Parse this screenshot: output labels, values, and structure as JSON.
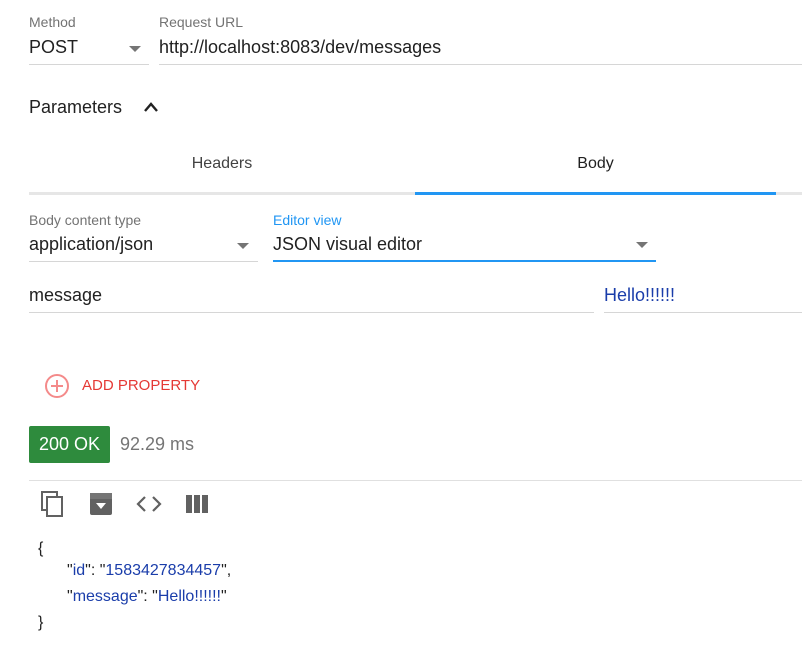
{
  "request": {
    "method_label": "Method",
    "method_value": "POST",
    "url_label": "Request URL",
    "url_value": "http://localhost:8083/dev/messages"
  },
  "parameters": {
    "title": "Parameters",
    "tabs": [
      {
        "label": "Headers",
        "active": false
      },
      {
        "label": "Body",
        "active": true
      }
    ]
  },
  "body": {
    "content_type_label": "Body content type",
    "content_type_value": "application/json",
    "editor_view_label": "Editor view",
    "editor_view_value": "JSON visual editor",
    "property_name": "message",
    "property_value": "Hello!!!!!!",
    "add_property_label": "ADD PROPERTY"
  },
  "response": {
    "status": "200 OK",
    "time": "92.29 ms",
    "json": {
      "open": "{",
      "close": "}",
      "id_key": "id",
      "id_value": "1583427834457",
      "message_key": "message",
      "message_value": "Hello!!!!!!"
    }
  },
  "icons": [
    "copy-icon",
    "save-icon",
    "code-icon",
    "columns-icon",
    "add-circle-icon",
    "chevron-up-icon",
    "dropdown-arrow-icon"
  ],
  "colors": {
    "accent": "#2196f3",
    "status_ok": "#2e8b3d",
    "add_property": "#e53935",
    "json_text": "#1a3daa"
  }
}
